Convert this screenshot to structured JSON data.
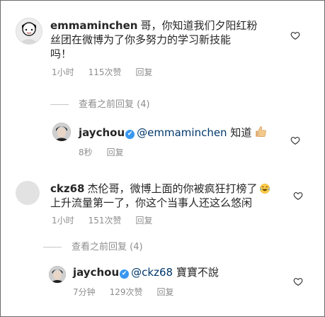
{
  "comments": [
    {
      "username": "emmaminchen",
      "text_line1": "哥，你知道我们夕阳红粉",
      "text_line2": "丝团在微博为了你多努力的学习新技能",
      "text_line3": "吗！",
      "time": "1小时",
      "likes": "115次赞",
      "reply_label": "回复",
      "view_replies": "查看之前回复 (4)"
    },
    {
      "username": "jaychou",
      "mention": "@emmaminchen",
      "text": "知道",
      "emoji": "thumbs-up-icon",
      "time": "8秒",
      "reply_label": "回复"
    },
    {
      "username": "ckz68",
      "text_line1": "杰伦哥，微博上面的你被疯狂打榜了",
      "text_line2": "上升流量第一了，你这个当事人还这么悠闲",
      "emoji": "laughing-face-icon",
      "time": "1小时",
      "likes": "151次赞",
      "reply_label": "回复",
      "view_replies": "查看之前回复 (4)"
    },
    {
      "username": "jaychou",
      "mention": "@ckz68",
      "text": "寶寶不說",
      "time": "7分钟",
      "likes": "129次赞",
      "reply_label": "回复"
    }
  ],
  "verified_badge": "✔",
  "colors": {
    "verified": "#3897f0",
    "mention": "#00376b",
    "meta": "#8e8e8e"
  }
}
